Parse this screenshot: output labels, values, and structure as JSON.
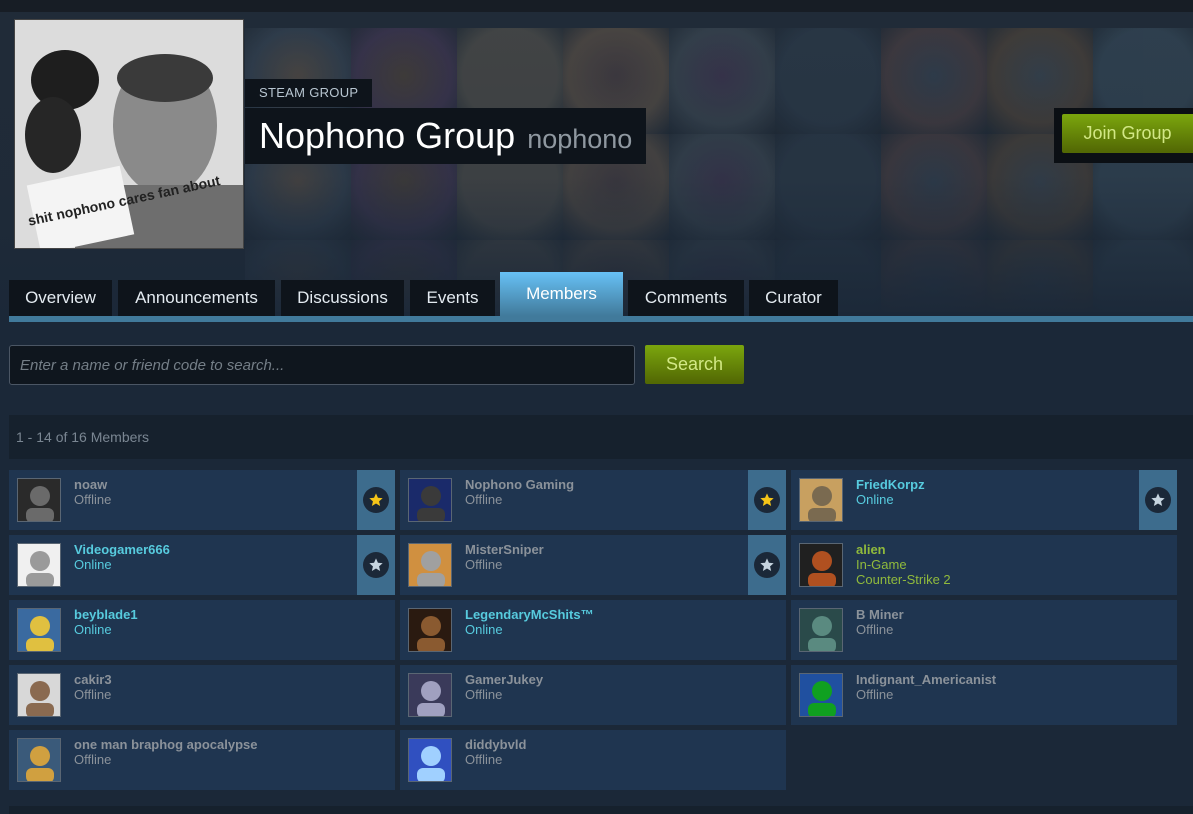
{
  "group": {
    "type_label": "STEAM GROUP",
    "name": "Nophono Group",
    "abbreviation": "nophono",
    "avatar_caption": "shit nophono cares fan about",
    "join_label": "Join Group"
  },
  "tabs": [
    {
      "label": "Overview"
    },
    {
      "label": "Announcements"
    },
    {
      "label": "Discussions"
    },
    {
      "label": "Events"
    },
    {
      "label": "Members",
      "active": true
    },
    {
      "label": "Comments"
    },
    {
      "label": "Curator"
    }
  ],
  "search": {
    "placeholder": "Enter a name or friend code to search...",
    "button_label": "Search"
  },
  "members_count": "1 - 14 of 16 Members",
  "members": [
    {
      "name": "noaw",
      "status": "Offline",
      "state": "offline",
      "rank": "owner"
    },
    {
      "name": "Nophono Gaming",
      "status": "Offline",
      "state": "offline",
      "rank": "owner"
    },
    {
      "name": "FriedKorpz",
      "status": "Online",
      "state": "online",
      "rank": "officer"
    },
    {
      "name": "Videogamer666",
      "status": "Online",
      "state": "online",
      "rank": "officer"
    },
    {
      "name": "MisterSniper",
      "status": "Offline",
      "state": "offline",
      "rank": "officer"
    },
    {
      "name": "alien",
      "status": "In-Game",
      "game": "Counter-Strike 2",
      "state": "ingame"
    },
    {
      "name": "beyblade1",
      "status": "Online",
      "state": "online"
    },
    {
      "name": "LegendaryMcShits™",
      "status": "Online",
      "state": "online"
    },
    {
      "name": "B Miner",
      "status": "Offline",
      "state": "offline"
    },
    {
      "name": "cakir3",
      "status": "Offline",
      "state": "offline"
    },
    {
      "name": "GamerJukey",
      "status": "Offline",
      "state": "offline"
    },
    {
      "name": "Indignant_Americanist",
      "status": "Offline",
      "state": "offline"
    },
    {
      "name": "one man braphog apocalypse",
      "status": "Offline",
      "state": "offline"
    },
    {
      "name": "diddybvld",
      "status": "Offline",
      "state": "offline"
    }
  ],
  "colors": {
    "background": "#1b2838",
    "member_card": "#1f3550",
    "online": "#57cbde",
    "offline": "#8b929a",
    "ingame": "#90ba3c",
    "active_tab": "#67c1f5",
    "button_green": "#79a30d",
    "owner_star": "#f5c518",
    "officer_star": "#c6d4df"
  }
}
